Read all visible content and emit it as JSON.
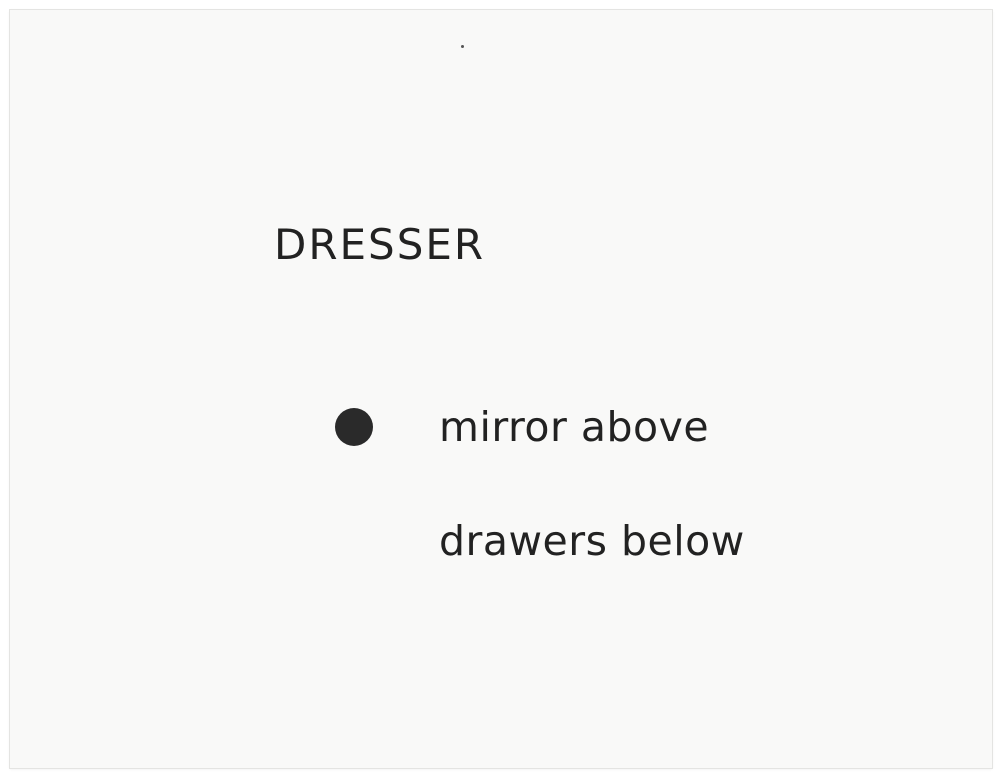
{
  "card": {
    "title": "DRESSER",
    "lines": [
      "mirror above",
      "drawers below"
    ],
    "bullet_color": "#2a2a2a"
  }
}
